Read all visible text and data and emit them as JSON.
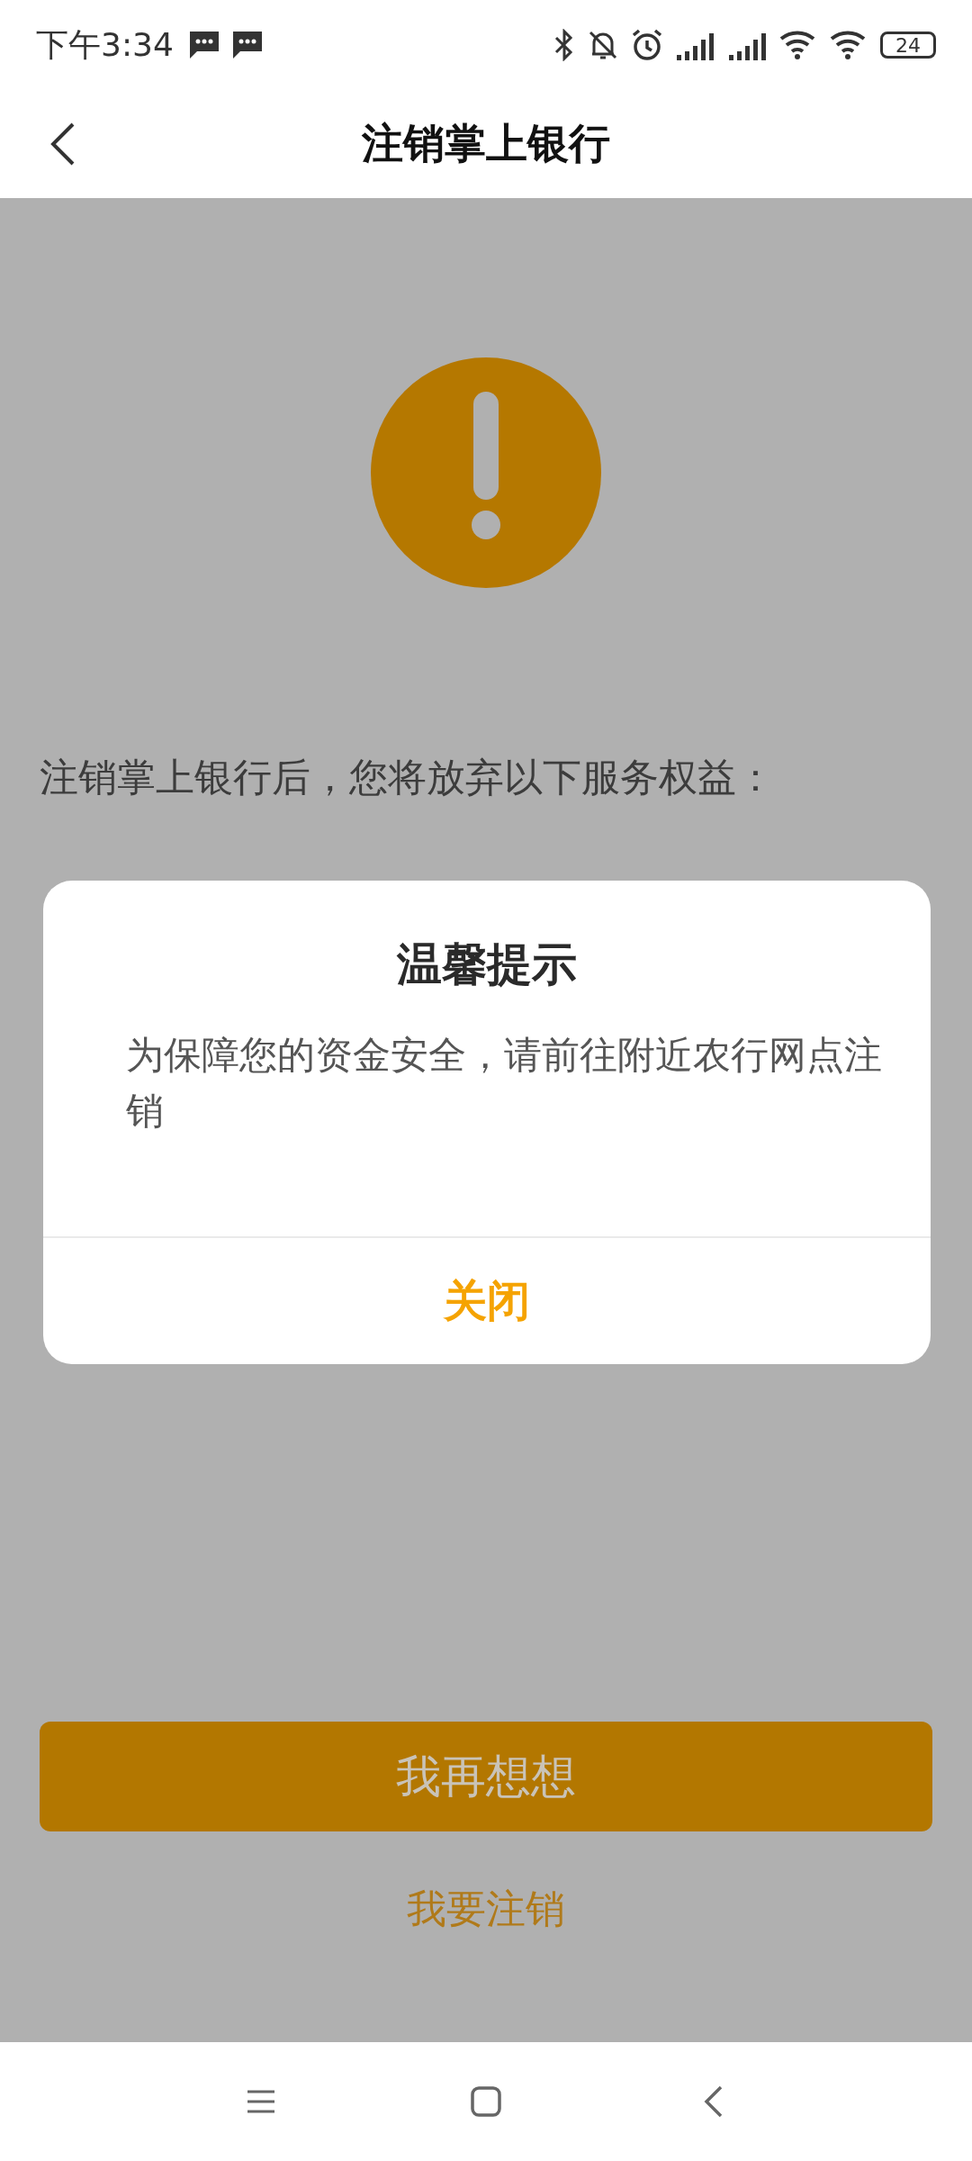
{
  "status_bar": {
    "time": "下午3:34",
    "battery": "24"
  },
  "header": {
    "title": "注销掌上银行"
  },
  "notice": {
    "intro": "注销掌上银行后，您将放弃以下服务权益："
  },
  "dialog": {
    "title": "温馨提示",
    "message": "为保障您的资金安全，请前往附近农行网点注销",
    "button": "关闭"
  },
  "actions": [
    {
      "label": "我再想想",
      "kind": "primary"
    },
    {
      "label": "我要注销",
      "kind": "link"
    }
  ]
}
